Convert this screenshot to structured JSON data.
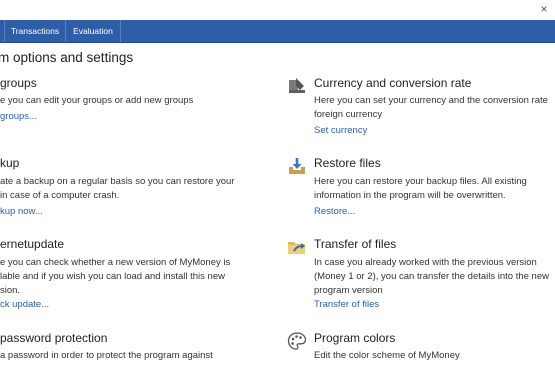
{
  "tabs": [
    {
      "label": ""
    },
    {
      "label": "Transactions"
    },
    {
      "label": "Evaluation"
    }
  ],
  "page_title": "m options and settings",
  "left": [
    {
      "title": "groups",
      "desc": [
        "e you can edit your groups or add new groups"
      ],
      "link": "groups..."
    },
    {
      "title": "kup",
      "desc": [
        "ate a backup on a regular basis so you can restore your",
        "in case of a computer crash."
      ],
      "link": "kup now..."
    },
    {
      "title": "ernetupdate",
      "desc": [
        "e you can check whether a new version of MyMoney is",
        "lable and if you wish you can load and install this new",
        "sion."
      ],
      "link": "ck update..."
    },
    {
      "title": "password protection",
      "desc": [
        "a password in order to protect the program against"
      ],
      "link": ""
    }
  ],
  "right": [
    {
      "title": "Currency and conversion rate",
      "desc": [
        "Here you can set your currency and the conversion rate",
        "foreign currency"
      ],
      "link": "Set currency",
      "icon": "currency-icon"
    },
    {
      "title": "Restore files",
      "desc": [
        "Here you can restore your backup files. All existing",
        "information in the program will be overwritten."
      ],
      "link": "Restore...",
      "icon": "restore-icon"
    },
    {
      "title": "Transfer of files",
      "desc": [
        "In case you already worked with the previous version",
        "(Money 1 or 2), you can transfer the details into the new",
        "program version"
      ],
      "link": "Transfer of files",
      "icon": "transfer-icon"
    },
    {
      "title": "Program colors",
      "desc": [
        "Edit the color scheme of MyMoney"
      ],
      "link": "",
      "icon": "palette-icon"
    }
  ],
  "colors": {
    "tabbar": "#2f5ea8",
    "link": "#2a5fb8"
  }
}
